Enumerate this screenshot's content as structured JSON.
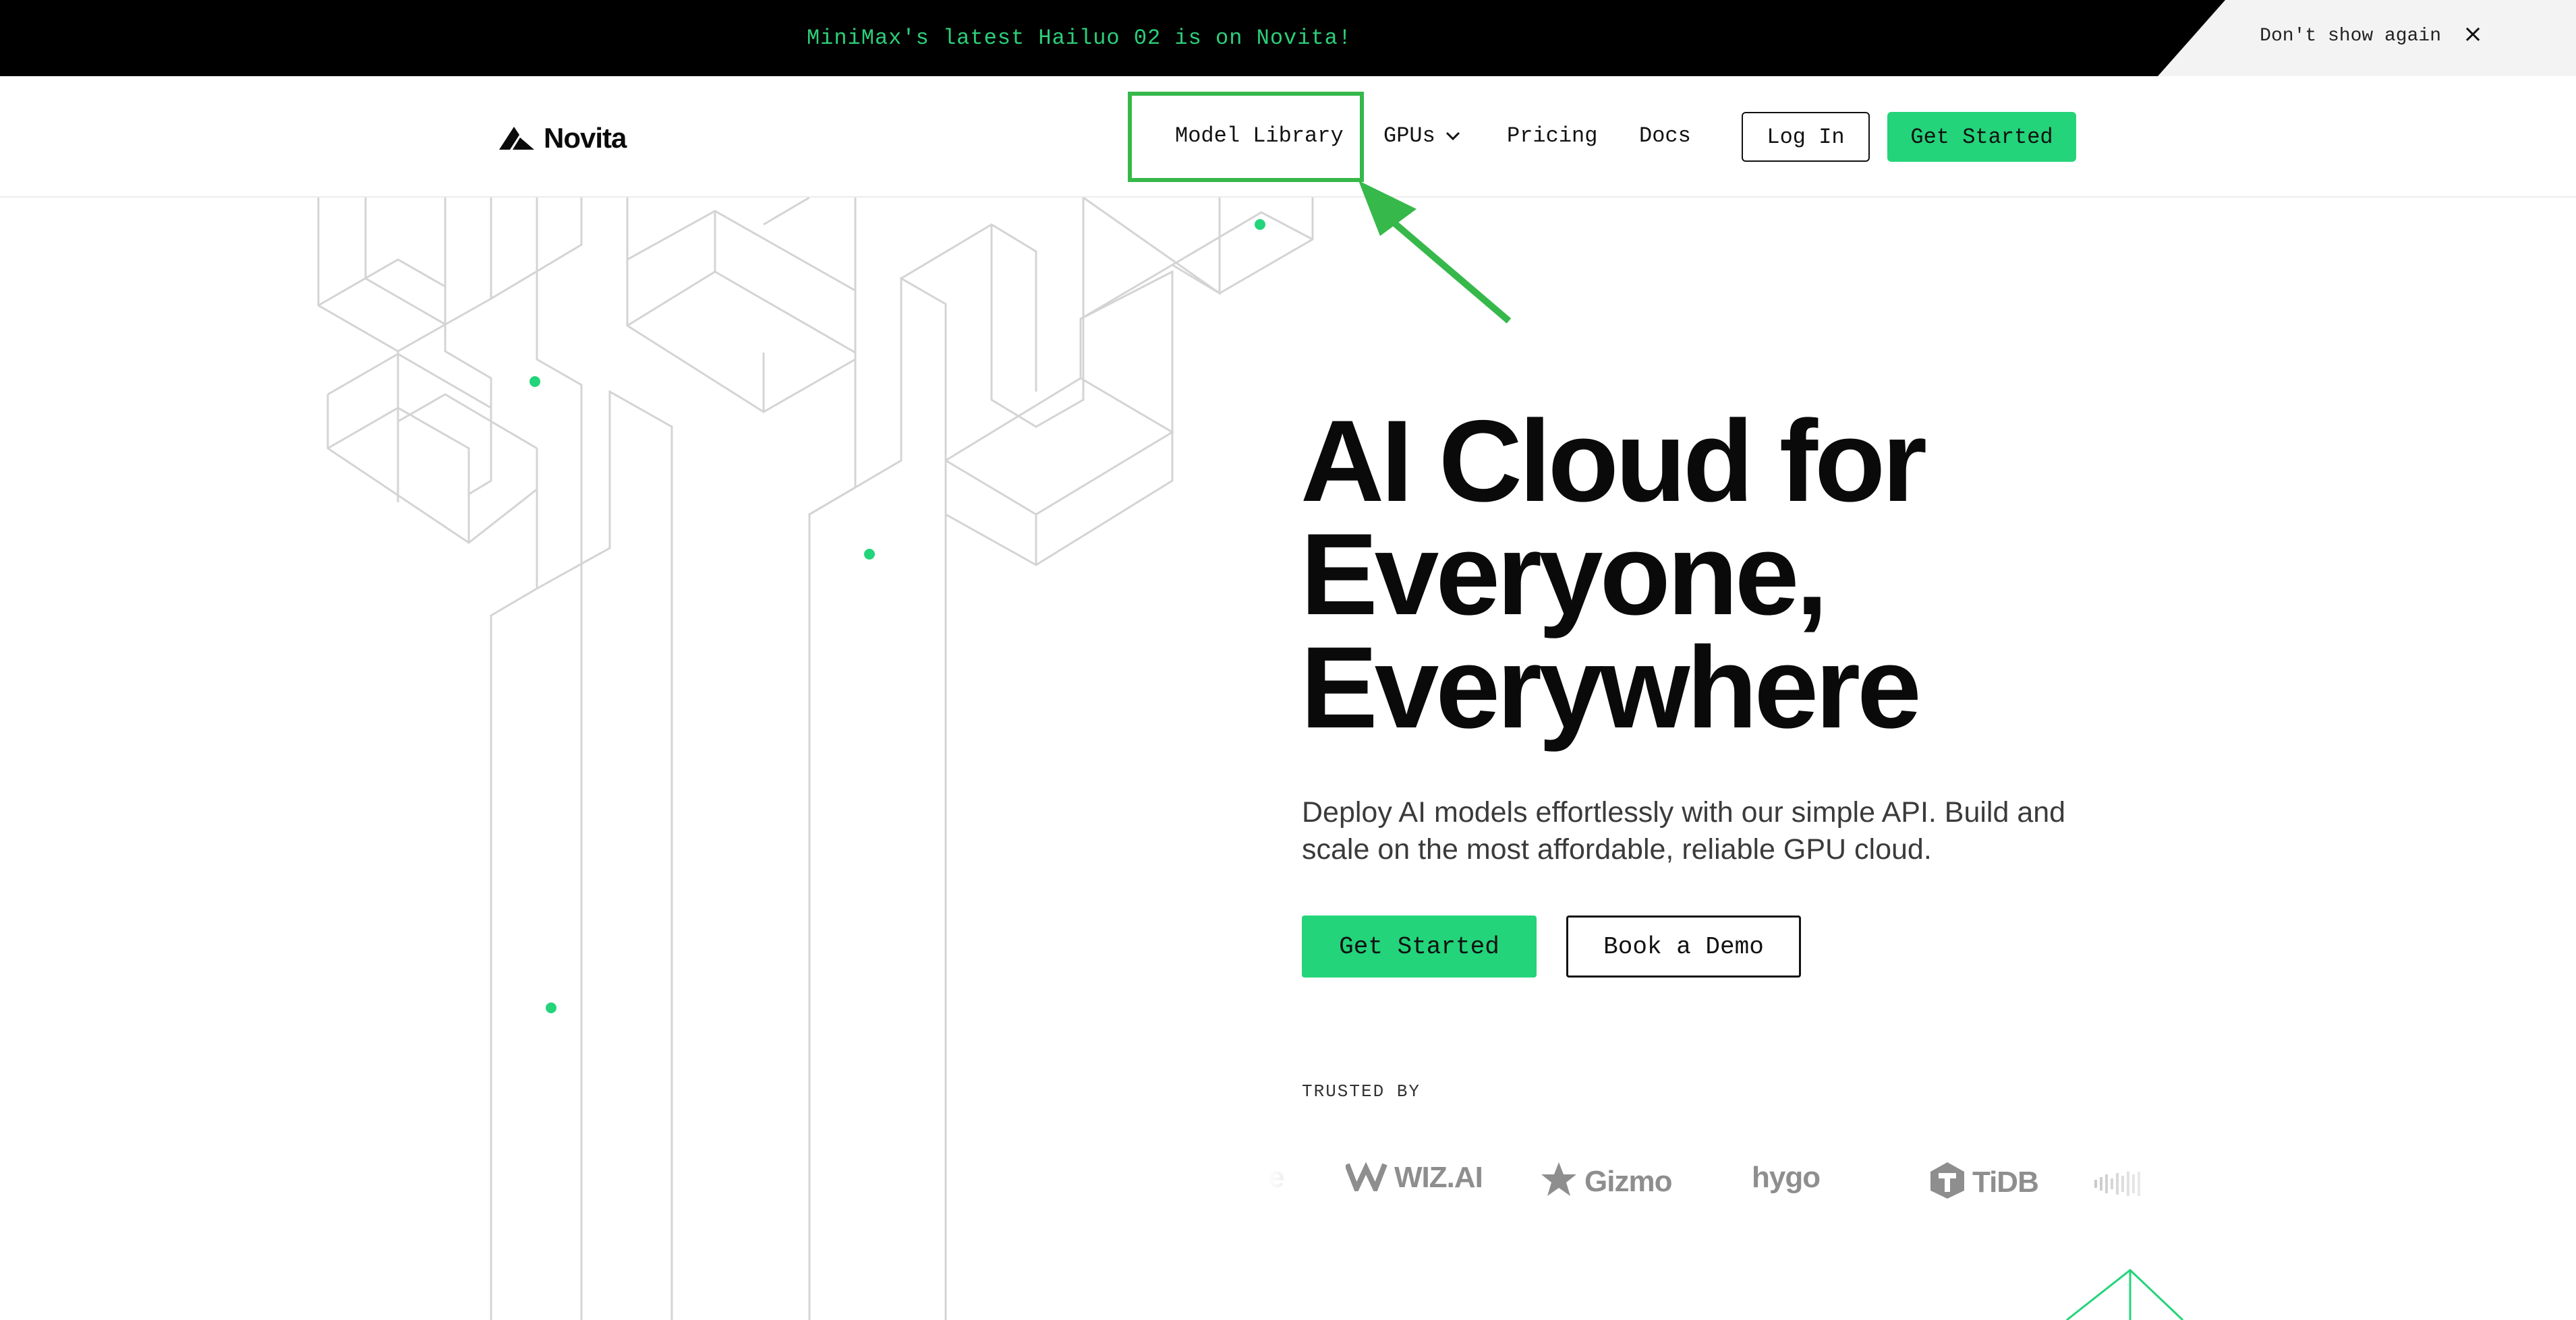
{
  "announcement": {
    "text": "MiniMax's latest Hailuo 02 is on Novita!",
    "dont_show_label": "Don't show again",
    "close_icon": "close-icon"
  },
  "header": {
    "logo_text": "Novita",
    "nav": {
      "model_library": "Model Library",
      "gpus": "GPUs",
      "pricing": "Pricing",
      "docs": "Docs"
    },
    "login_label": "Log In",
    "get_started_label": "Get Started"
  },
  "hero": {
    "title_line1": "AI Cloud for",
    "title_line2": "Everyone,",
    "title_line3": "Everywhere",
    "subtitle": "Deploy AI models effortlessly with our simple API. Build and scale on the most affordable, reliable GPU cloud.",
    "get_started_label": "Get Started",
    "book_demo_label": "Book a Demo"
  },
  "trusted": {
    "label": "TRUSTED BY",
    "logos": [
      {
        "name": "WIZ.AI",
        "icon": "wiz-logo-icon"
      },
      {
        "name": "Gizmo",
        "icon": "gizmo-star-icon"
      },
      {
        "name": "hygo",
        "icon": ""
      },
      {
        "name": "TiDB",
        "icon": "tidb-logo-icon"
      }
    ]
  },
  "colors": {
    "accent": "#23d47a",
    "announcement_text": "#2ccf7a",
    "highlight_box": "#36b84a"
  }
}
